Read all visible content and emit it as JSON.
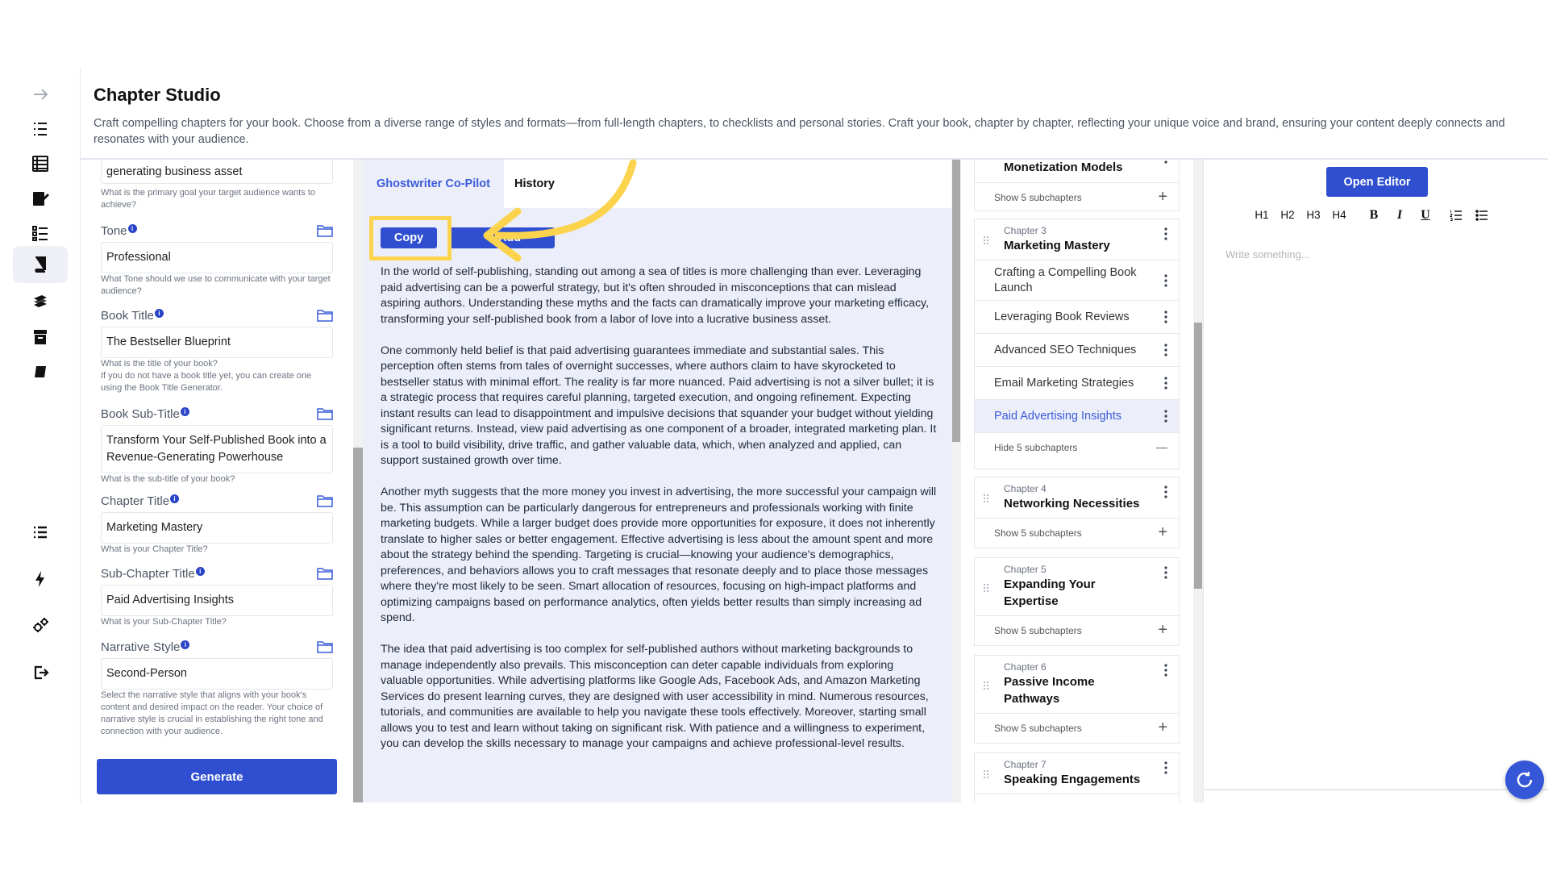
{
  "header": {
    "title": "Chapter Studio",
    "description": "Craft compelling chapters for your book. Choose from a diverse range of styles and formats—from full-length chapters, to checklists and personal stories. Craft your book, chapter by chapter, reflecting your unique voice and brand, ensuring your content deeply connects and resonates with your audience."
  },
  "form": {
    "goal_value": "generating business asset",
    "goal_help": "What is the primary goal your target audience wants to achieve?",
    "tone_label": "Tone",
    "tone_value": "Professional",
    "tone_help": "What Tone should we use to communicate with your target audience?",
    "book_title_label": "Book Title",
    "book_title_value": "The Bestseller Blueprint",
    "book_title_help_1": "What is the title of your book?",
    "book_title_help_2": "If you do not have a book title yet, you can create one using the Book Title Generator.",
    "book_subtitle_label": "Book Sub-Title",
    "book_subtitle_value": "Transform Your Self-Published Book into a Revenue-Generating Powerhouse",
    "book_subtitle_help": "What is the sub-title of your book?",
    "chapter_title_label": "Chapter Title",
    "chapter_title_value": "Marketing Mastery",
    "chapter_title_help": "What is your Chapter Title?",
    "subchapter_title_label": "Sub-Chapter Title",
    "subchapter_title_value": "Paid Advertising Insights",
    "subchapter_title_help": "What is your Sub-Chapter Title?",
    "narrative_label": "Narrative Style",
    "narrative_value": "Second-Person",
    "narrative_help": "Select the narrative style that aligns with your book's content and desired impact on the reader. Your choice of narrative style is crucial in establishing the right tone and connection with your audience.",
    "info_glyph": "i",
    "generate_label": "Generate"
  },
  "copilot": {
    "tab_active": "Ghostwriter Co-Pilot",
    "tab_history": "History",
    "copy_label": "Copy",
    "add_label": "+ Add",
    "paragraphs": [
      "In the world of self-publishing, standing out among a sea of titles is more challenging than ever. Leveraging paid advertising can be a powerful strategy, but it's often shrouded in misconceptions that can mislead aspiring authors. Understanding these myths and the facts can dramatically improve your marketing efficacy, transforming your self-published book from a labor of love into a lucrative business asset.",
      "One commonly held belief is that paid advertising guarantees immediate and substantial sales. This perception often stems from tales of overnight successes, where authors claim to have skyrocketed to bestseller status with minimal effort. The reality is far more nuanced. Paid advertising is not a silver bullet; it is a strategic process that requires careful planning, targeted execution, and ongoing refinement. Expecting instant results can lead to disappointment and impulsive decisions that squander your budget without yielding significant returns. Instead, view paid advertising as one component of a broader, integrated marketing plan. It is a tool to build visibility, drive traffic, and gather valuable data, which, when analyzed and applied, can support sustained growth over time.",
      "Another myth suggests that the more money you invest in advertising, the more successful your campaign will be. This assumption can be particularly dangerous for entrepreneurs and professionals working with finite marketing budgets. While a larger budget does provide more opportunities for exposure, it does not inherently translate to higher sales or better engagement. Effective advertising is less about the amount spent and more about the strategy behind the spending. Targeting is crucial—knowing your audience's demographics, preferences, and behaviors allows you to craft messages that resonate deeply and to place those messages where they're most likely to be seen. Smart allocation of resources, focusing on high-impact platforms and optimizing campaigns based on performance analytics, often yields better results than simply increasing ad spend.",
      "The idea that paid advertising is too complex for self-published authors without marketing backgrounds to manage independently also prevails. This misconception can deter capable individuals from exploring valuable opportunities. While advertising platforms like Google Ads, Facebook Ads, and Amazon Marketing Services do present learning curves, they are designed with user accessibility in mind. Numerous resources, tutorials, and communities are available to help you navigate these tools effectively. Moreover, starting small allows you to test and learn without taking on significant risk. With patience and a willingness to experiment, you can develop the skills necessary to manage your campaigns and achieve professional-level results."
    ]
  },
  "chapters": {
    "card2_title": "Monetization Models",
    "card2_toggle": "Show 5 subchapters",
    "card3_no": "Chapter 3",
    "card3_title": "Marketing Mastery",
    "subs": [
      "Crafting a Compelling Book Launch",
      "Leveraging Book Reviews",
      "Advanced SEO Techniques",
      "Email Marketing Strategies",
      "Paid Advertising Insights"
    ],
    "card3_toggle": "Hide 5 subchapters",
    "card4_no": "Chapter 4",
    "card4_title": "Networking Necessities",
    "card4_toggle": "Show 5 subchapters",
    "card5_no": "Chapter 5",
    "card5_title": "Expanding Your Expertise",
    "card5_toggle": "Show 5 subchapters",
    "card6_no": "Chapter 6",
    "card6_title": "Passive Income Pathways",
    "card6_toggle": "Show 5 subchapters",
    "card7_no": "Chapter 7",
    "card7_title": "Speaking Engagements",
    "plus": "+",
    "minus": "—"
  },
  "editor": {
    "open_label": "Open Editor",
    "h1": "H1",
    "h2": "H2",
    "h3": "H3",
    "h4": "H4",
    "bold": "B",
    "italic": "I",
    "underline": "U",
    "placeholder": "Write something..."
  },
  "colors": {
    "accent": "#2f4fd0",
    "highlight": "#fcd34d",
    "panel_bg": "#eceef9"
  }
}
